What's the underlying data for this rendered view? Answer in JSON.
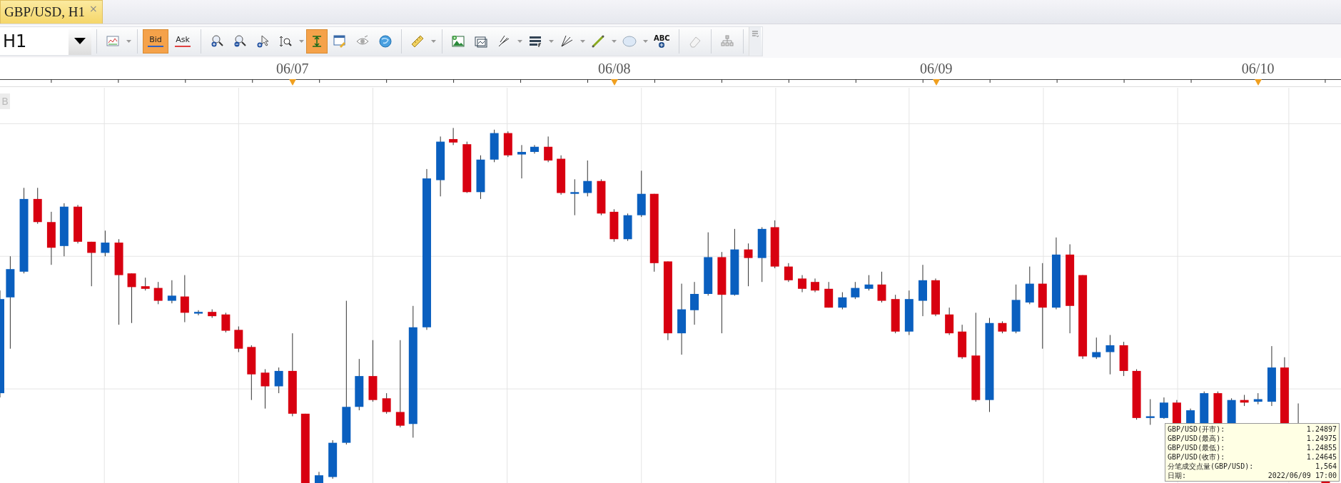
{
  "tabs": [
    {
      "label": "GBP/USD, H1",
      "selected": true,
      "close": "×"
    }
  ],
  "toolbar": {
    "timeframe": "H1",
    "tools": [
      {
        "kind": "icon",
        "selected": false,
        "dropdown": true
      },
      {
        "kind": "text",
        "label": "Bid",
        "color": "#3060c0",
        "selected": true,
        "dropdown": false
      },
      {
        "kind": "text",
        "label": "Ask",
        "color": "#e04040",
        "selected": false,
        "dropdown": false
      },
      {
        "kind": "icon",
        "selected": false,
        "dropdown": false
      },
      {
        "kind": "icon",
        "selected": false,
        "dropdown": false
      },
      {
        "kind": "icon",
        "selected": false,
        "dropdown": false
      },
      {
        "kind": "icon",
        "selected": false,
        "dropdown": true
      },
      {
        "kind": "icon",
        "selected": true,
        "dropdown": false
      },
      {
        "kind": "icon",
        "selected": false,
        "dropdown": false
      },
      {
        "kind": "icon",
        "selected": false,
        "dropdown": false
      },
      {
        "kind": "icon",
        "selected": false,
        "dropdown": false
      },
      {
        "kind": "icon",
        "selected": false,
        "dropdown": true
      },
      {
        "kind": "icon",
        "selected": false,
        "dropdown": false
      },
      {
        "kind": "icon",
        "selected": false,
        "dropdown": false
      },
      {
        "kind": "icon",
        "selected": false,
        "dropdown": true
      },
      {
        "kind": "icon",
        "selected": false,
        "dropdown": true
      },
      {
        "kind": "icon",
        "selected": false,
        "dropdown": true
      },
      {
        "kind": "icon",
        "selected": false,
        "dropdown": true
      },
      {
        "kind": "icon",
        "selected": false,
        "dropdown": true
      },
      {
        "kind": "label-icon",
        "label": "ABC",
        "selected": false,
        "dropdown": false
      },
      {
        "kind": "icon",
        "selected": false,
        "dropdown": false
      },
      {
        "kind": "icon",
        "selected": false,
        "dropdown": false
      }
    ]
  },
  "time_axis": {
    "dates": [
      "06/07",
      "06/08",
      "06/09",
      "06/10"
    ]
  },
  "chart": {
    "corner_label": "B",
    "tooltip": [
      {
        "label": "GBP/USD(开市):",
        "value": "1.24897"
      },
      {
        "label": "GBP/USD(最高):",
        "value": "1.24975"
      },
      {
        "label": "GBP/USD(最低):",
        "value": "1.24855"
      },
      {
        "label": "GBP/USD(收市):",
        "value": "1.24645"
      },
      {
        "label": "分笔成交点量(GBP/USD):",
        "value": "1,564"
      },
      {
        "label": "日期:",
        "value": "2022/06/09 17:00"
      }
    ]
  }
}
